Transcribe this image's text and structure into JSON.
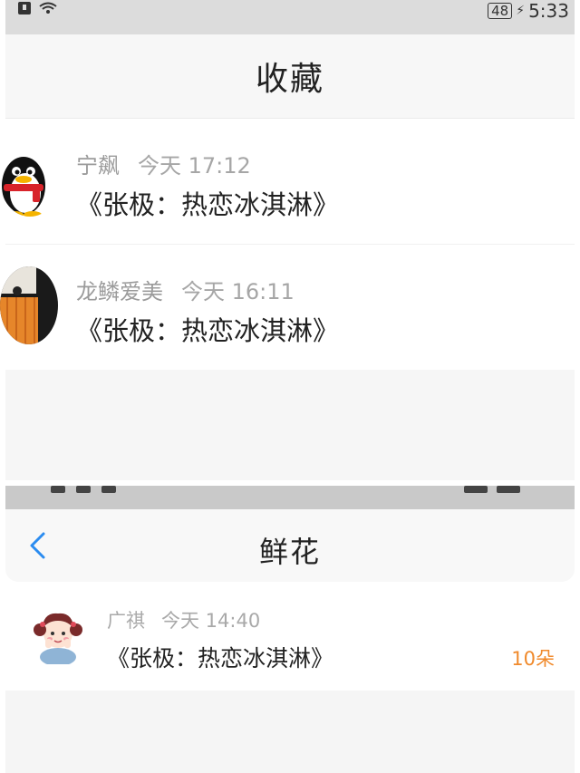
{
  "top_screen": {
    "status_bar": {
      "battery": "48",
      "time": "5:33"
    },
    "title": "收藏",
    "items": [
      {
        "name": "宁飙",
        "time": "今天 17:12",
        "title": "《张极：热恋冰淇淋》",
        "avatar": "qq-penguin-icon"
      },
      {
        "name": "龙鳞爱美",
        "time": "今天 16:11",
        "title": "《张极：热恋冰淇淋》",
        "avatar": "profile-photo"
      }
    ]
  },
  "bottom_screen": {
    "title": "鲜花",
    "items": [
      {
        "name": "广祺",
        "time": "今天 14:40",
        "title": "《张极：热恋冰淇淋》",
        "count": "10朵",
        "avatar": "cartoon-girl-icon"
      }
    ]
  },
  "colors": {
    "accent": "#2b8cf0",
    "count": "#f08a2c",
    "meta": "#a6a6a6"
  }
}
